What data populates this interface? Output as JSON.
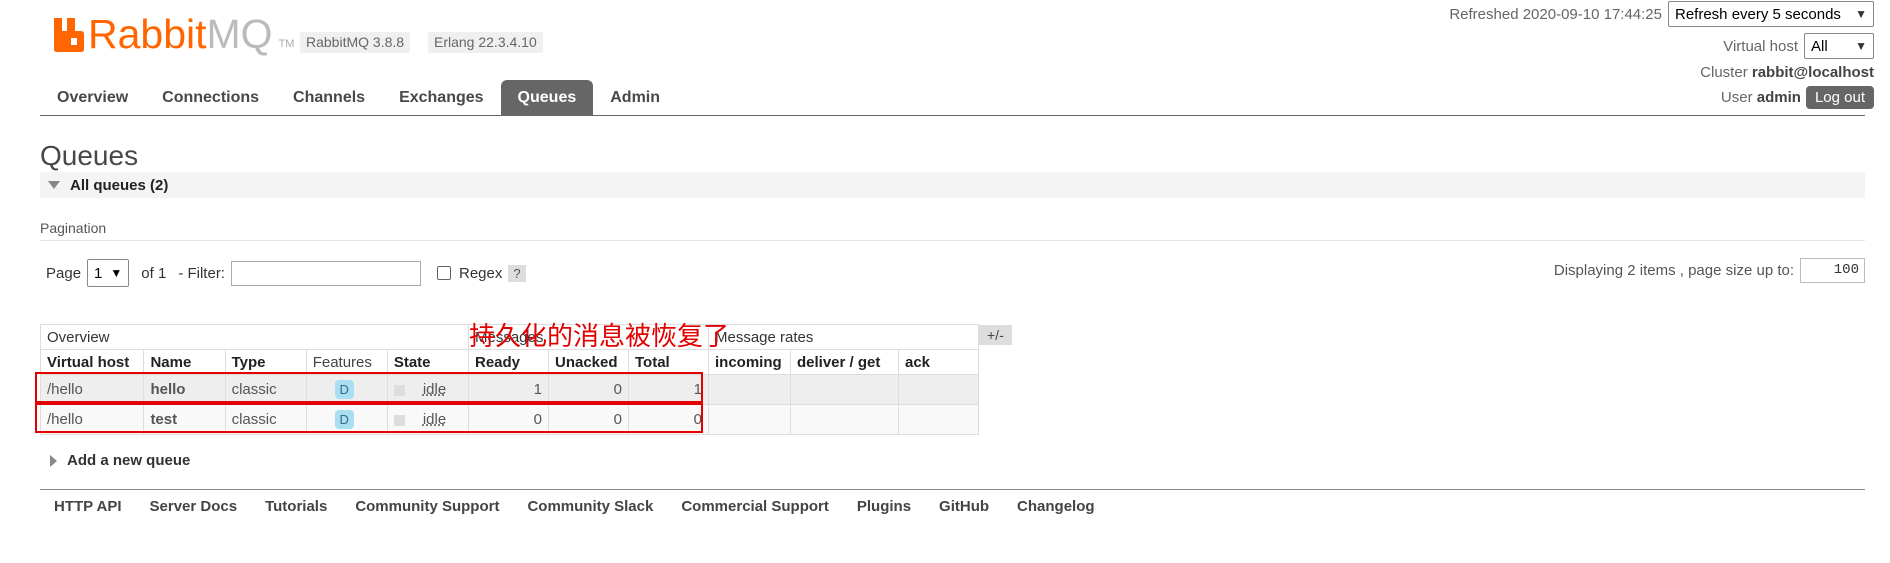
{
  "app": {
    "logo_text_a": "Rabbit",
    "logo_text_b": "MQ",
    "logo_tm": "TM",
    "version": "RabbitMQ 3.8.8",
    "erlang": "Erlang 22.3.4.10"
  },
  "header": {
    "refreshed_label": "Refreshed 2020-09-10 17:44:25",
    "refresh_select": "Refresh every 5 seconds",
    "vhost_label": "Virtual host",
    "vhost_select": "All",
    "cluster_label": "Cluster",
    "cluster_value": "rabbit@localhost",
    "user_label": "User",
    "user_value": "admin",
    "logout": "Log out"
  },
  "nav": {
    "tabs": [
      {
        "label": "Overview",
        "active": false
      },
      {
        "label": "Connections",
        "active": false
      },
      {
        "label": "Channels",
        "active": false
      },
      {
        "label": "Exchanges",
        "active": false
      },
      {
        "label": "Queues",
        "active": true
      },
      {
        "label": "Admin",
        "active": false
      }
    ]
  },
  "page": {
    "title": "Queues",
    "section": "All queues (2)",
    "pagination_label": "Pagination",
    "page_label": "Page",
    "page_value": "1",
    "of_label": "of 1",
    "filter_label": "- Filter:",
    "regex_label": "Regex",
    "help": "?",
    "displaying": "Displaying 2 items , page size up to:",
    "page_size": "100",
    "plus_minus": "+/-",
    "add_queue": "Add a new queue"
  },
  "table": {
    "groups": {
      "overview": "Overview",
      "messages": "Messages",
      "message_rates": "Message rates"
    },
    "columns": [
      "Virtual host",
      "Name",
      "Type",
      "Features",
      "State",
      "Ready",
      "Unacked",
      "Total",
      "incoming",
      "deliver / get",
      "ack"
    ],
    "rows": [
      {
        "vhost": "/hello",
        "name": "hello",
        "type": "classic",
        "feature": "D",
        "state": "idle",
        "ready": "1",
        "unacked": "0",
        "total": "1"
      },
      {
        "vhost": "/hello",
        "name": "test",
        "type": "classic",
        "feature": "D",
        "state": "idle",
        "ready": "0",
        "unacked": "0",
        "total": "0"
      }
    ]
  },
  "annotation": "持久化的消息被恢复了",
  "footer": [
    "HTTP API",
    "Server Docs",
    "Tutorials",
    "Community Support",
    "Community Slack",
    "Commercial Support",
    "Plugins",
    "GitHub",
    "Changelog"
  ],
  "colors": {
    "brand": "#ff6600",
    "active_tab": "#666666",
    "annotation": "#e30000"
  }
}
